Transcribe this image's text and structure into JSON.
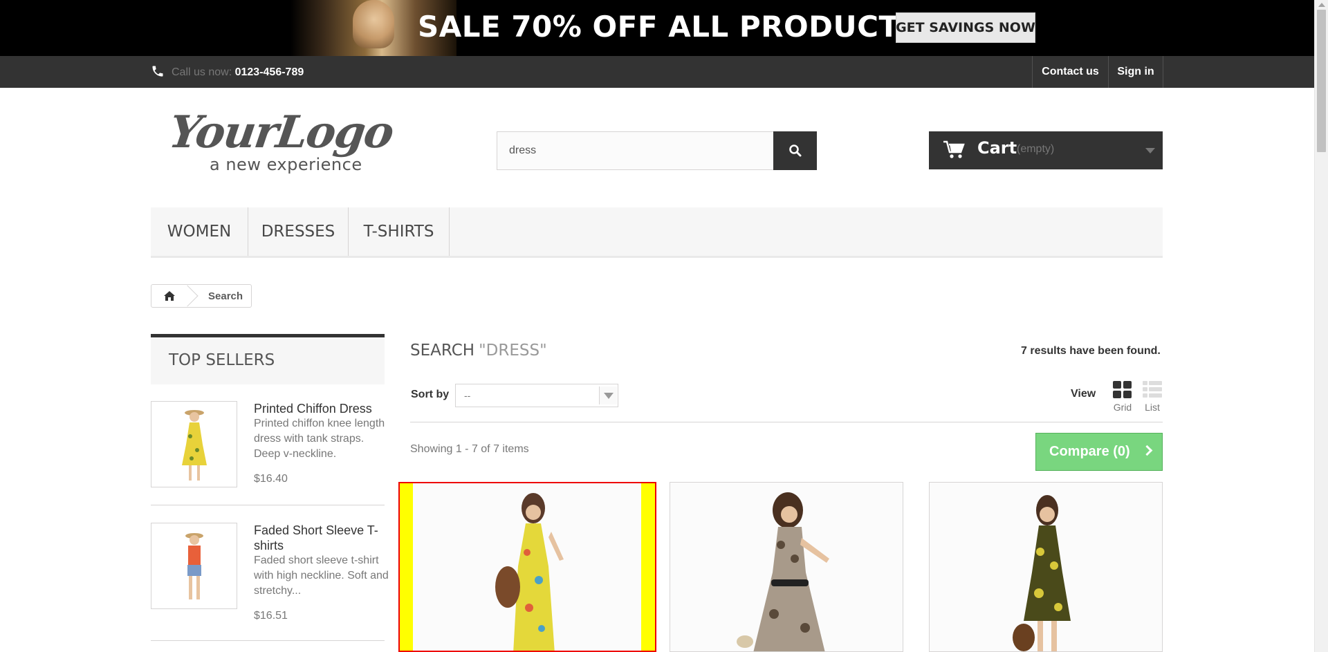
{
  "banner": {
    "text": "SALE 70% OFF ALL PRODUCTS",
    "button": "GET SAVINGS NOW"
  },
  "topnav": {
    "call_label": "Call us now:",
    "phone": "0123-456-789",
    "contact": "Contact us",
    "signin": "Sign in"
  },
  "header": {
    "logo_main": "YourLogo",
    "logo_sub": "a new experience",
    "search_value": "dress",
    "cart_label": "Cart",
    "cart_status": "(empty)"
  },
  "menu": {
    "items": [
      {
        "label": "WOMEN"
      },
      {
        "label": "DRESSES"
      },
      {
        "label": "T-SHIRTS"
      }
    ]
  },
  "breadcrumb": {
    "current": "Search"
  },
  "sidebar": {
    "title": "TOP SELLERS",
    "items": [
      {
        "name": "Printed Chiffon Dress",
        "desc": "Printed chiffon knee length dress with tank straps. Deep v-neckline.",
        "price": "$16.40"
      },
      {
        "name": "Faded Short Sleeve T-shirts",
        "desc": "Faded short sleeve t-shirt with high neckline. Soft and stretchy...",
        "price": "$16.51"
      }
    ]
  },
  "main": {
    "heading": "SEARCH",
    "query": "\"DRESS\"",
    "results": "7 results have been found.",
    "sort_label": "Sort by",
    "sort_value": "--",
    "view_label": "View",
    "view_grid": "Grid",
    "view_list": "List",
    "showing": "Showing 1 - 7 of 7 items",
    "compare": "Compare (0)"
  },
  "colors": {
    "dark": "#333333",
    "compare_green": "#79d67f",
    "highlight_yellow": "#ffff00",
    "highlight_red": "#ee0000"
  }
}
